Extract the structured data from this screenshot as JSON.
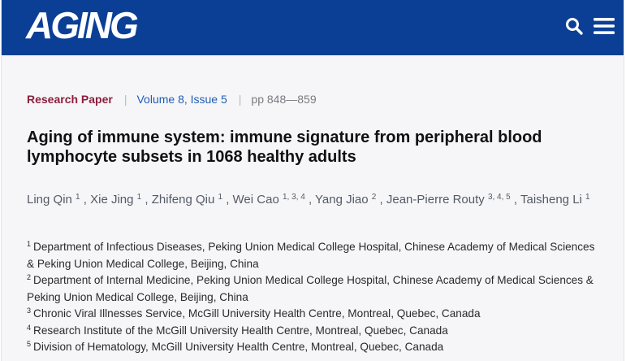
{
  "header": {
    "logo_text": "AGING",
    "search_icon": "search-icon",
    "menu_icon": "hamburger-menu-icon",
    "background_color": "#0b3f96"
  },
  "meta": {
    "paper_type": "Research Paper",
    "volume_issue": "Volume 8, Issue 5",
    "pages": "pp 848—859",
    "separator": "|"
  },
  "title": "Aging of immune system: immune signature from peripheral blood lymphocyte subsets in 1068 healthy adults",
  "authors": [
    {
      "name": "Ling Qin",
      "aff": "1"
    },
    {
      "name": "Xie Jing",
      "aff": "1"
    },
    {
      "name": "Zhifeng Qiu",
      "aff": "1"
    },
    {
      "name": "Wei Cao",
      "aff": "1, 3, 4"
    },
    {
      "name": "Yang Jiao",
      "aff": "2"
    },
    {
      "name": "Jean-Pierre Routy",
      "aff": "3, 4, 5"
    },
    {
      "name": "Taisheng Li",
      "aff": "1"
    }
  ],
  "affiliations": [
    {
      "num": "1",
      "text": "Department of Infectious Diseases, Peking Union Medical College Hospital, Chinese Academy of Medical Sciences & Peking Union Medical College, Beijing, China"
    },
    {
      "num": "2",
      "text": "Department of Internal Medicine, Peking Union Medical College Hospital, Chinese Academy of Medical Sciences & Peking Union Medical College, Beijing, China"
    },
    {
      "num": "3",
      "text": "Chronic Viral Illnesses Service, McGill University Health Centre, Montreal, Quebec, Canada"
    },
    {
      "num": "4",
      "text": "Research Institute of the McGill University Health Centre, Montreal, Quebec, Canada"
    },
    {
      "num": "5",
      "text": "Division of Hematology, McGill University Health Centre, Montreal, Quebec, Canada"
    }
  ]
}
